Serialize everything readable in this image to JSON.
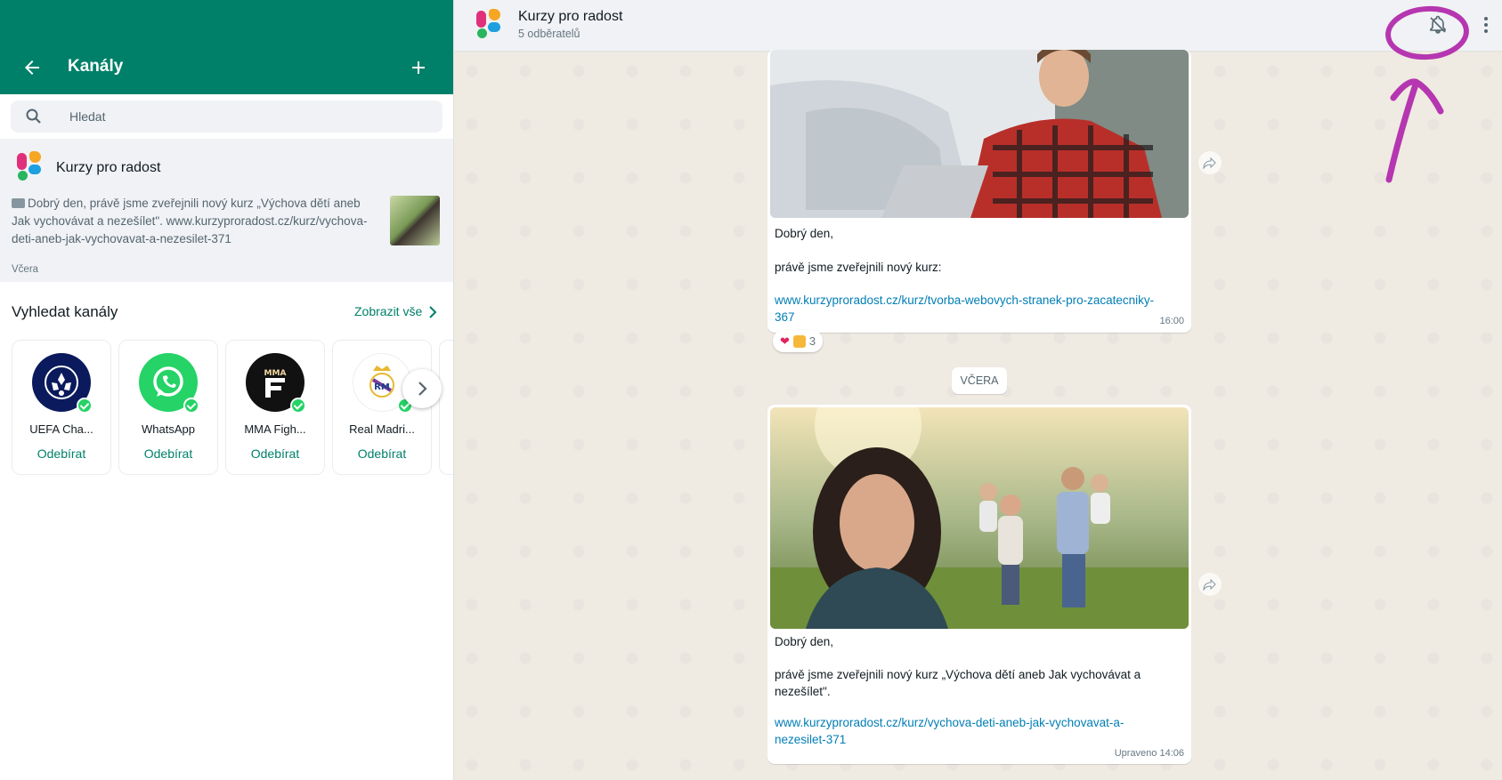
{
  "left_header": {
    "title": "Kanály"
  },
  "search": {
    "placeholder": "Hledat"
  },
  "channel_item": {
    "name": "Kurzy pro radost",
    "preview": "Dobrý den,  právě jsme zveřejnili nový kurz „Výchova dětí aneb Jak vychovávat a nezešílet\". www.kurzyproradost.cz/kurz/vychova-deti-aneb-jak-vychovavat-a-nezesilet-371",
    "date": "Včera"
  },
  "discover": {
    "heading": "Vyhledat kanály",
    "see_all": "Zobrazit vše",
    "cards": [
      {
        "name": "UEFA Cha...",
        "action": "Odebírat",
        "icon": "uefa-logo"
      },
      {
        "name": "WhatsApp",
        "action": "Odebírat",
        "icon": "whatsapp-logo"
      },
      {
        "name": "MMA Figh...",
        "action": "Odebírat",
        "icon": "mma-logo"
      },
      {
        "name": "Real Madri...",
        "action": "Odebírat",
        "icon": "real-madrid-logo"
      }
    ]
  },
  "chat_header": {
    "name": "Kurzy pro radost",
    "subscribers": "5 odběratelů"
  },
  "messages": [
    {
      "greeting": "Dobrý den,",
      "text": "právě jsme zveřejnili nový kurz:",
      "link_line1": "www.kurzyproradost.cz/kurz/tvorba-webovych-stranek-pro-zacatecniky-",
      "link_line2": "367",
      "time": "16:00",
      "reaction_count": "3"
    },
    {
      "greeting": "Dobrý den,",
      "text_line1": "právě jsme zveřejnili nový kurz „Výchova dětí aneb Jak vychovávat a",
      "text_line2": "nezešílet\".",
      "link_line1": "www.kurzyproradost.cz/kurz/vychova-deti-aneb-jak-vychovavat-a-",
      "link_line2": "nezesilet-371",
      "time": "Upraveno  14:06"
    }
  ],
  "date_divider": "VČERA",
  "colors": {
    "brand_green": "#008069",
    "chat_bg": "#efeae2",
    "annotation": "#b536b0"
  }
}
